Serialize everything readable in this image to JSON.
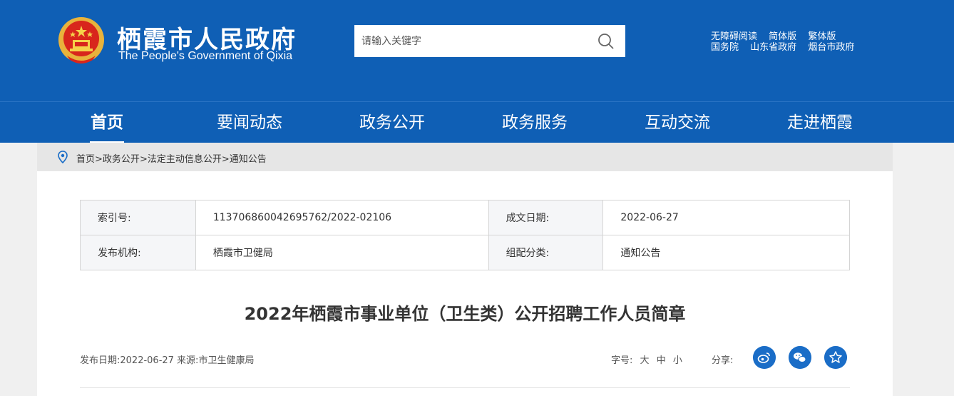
{
  "header": {
    "title_cn": "栖霞市人民政府",
    "title_en": "The People's Government of Qixia",
    "search_placeholder": "请输入关键字",
    "top_links_row1": [
      "无障碍阅读",
      "简体版",
      "繁体版"
    ],
    "top_links_row2": [
      "国务院",
      "山东省政府",
      "烟台市政府"
    ]
  },
  "nav": {
    "items": [
      "首页",
      "要闻动态",
      "政务公开",
      "政务服务",
      "互动交流",
      "走进栖霞"
    ],
    "active_index": 0
  },
  "breadcrumb": [
    "首页",
    "政务公开",
    "法定主动信息公开",
    "通知公告"
  ],
  "info": {
    "index_label": "索引号:",
    "index_value": "113706860042695762/2022-02106",
    "date_label": "成文日期:",
    "date_value": "2022-06-27",
    "org_label": "发布机构:",
    "org_value": "栖霞市卫健局",
    "category_label": "组配分类:",
    "category_value": "通知公告"
  },
  "article": {
    "title": "2022年栖霞市事业单位（卫生类）公开招聘工作人员简章",
    "meta": "发布日期:2022-06-27 来源:市卫生健康局",
    "fontsize_label": "字号:",
    "fontsize_options": [
      "大",
      "中",
      "小"
    ],
    "share_label": "分享:"
  },
  "colors": {
    "brand_blue": "#0f5fb5",
    "share_blue": "#1a6dc7"
  },
  "icons": [
    "national-emblem-icon",
    "search-icon",
    "location-pin-icon",
    "weibo-icon",
    "wechat-icon",
    "favorite-star-icon"
  ]
}
